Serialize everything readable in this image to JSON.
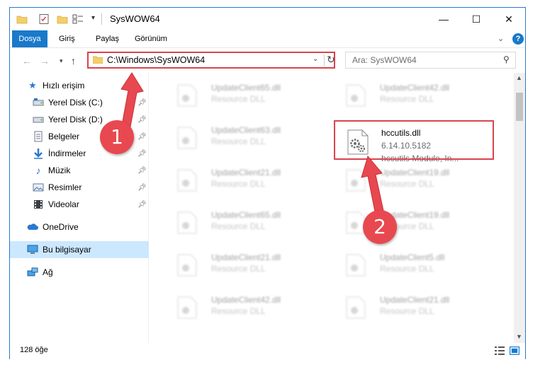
{
  "window": {
    "title": "SysWOW64",
    "controls": {
      "minimize": "—",
      "maximize": "☐",
      "close": "✕"
    }
  },
  "ribbon": {
    "tabs": [
      "Dosya",
      "Giriş",
      "Paylaş",
      "Görünüm"
    ],
    "help": "?"
  },
  "navigation": {
    "address": "C:\\Windows\\SysWOW64",
    "search_placeholder": "Ara: SysWOW64"
  },
  "sidebar": {
    "quick_access": "Hızlı erişim",
    "items": [
      {
        "label": "Yerel Disk (C:)",
        "icon": "drive-icon"
      },
      {
        "label": "Yerel Disk (D:)",
        "icon": "drive-icon"
      },
      {
        "label": "Belgeler",
        "icon": "documents-icon"
      },
      {
        "label": "İndirmeler",
        "icon": "downloads-icon"
      },
      {
        "label": "Müzik",
        "icon": "music-icon"
      },
      {
        "label": "Resimler",
        "icon": "pictures-icon"
      },
      {
        "label": "Videolar",
        "icon": "videos-icon"
      }
    ],
    "onedrive": "OneDrive",
    "this_pc": "Bu bilgisayar",
    "network": "Ağ"
  },
  "files": {
    "left_column": [
      {
        "name": "UpdateClient65.dll",
        "type": "Resource DLL"
      },
      {
        "name": "UpdateClient63.dll",
        "type": "Resource DLL"
      },
      {
        "name": "UpdateClient21.dll",
        "type": "Resource DLL"
      },
      {
        "name": "UpdateClient65.dll",
        "type": "Resource DLL"
      },
      {
        "name": "UpdateClient21.dll",
        "type": "Resource DLL"
      },
      {
        "name": "UpdateClient42.dll",
        "type": "Resource DLL"
      }
    ],
    "right_column": [
      {
        "name": "UpdateClient42.dll",
        "type": "Resource DLL"
      },
      {
        "name": "UpdateClient19.dll",
        "type": "Resource DLL"
      },
      {
        "name": "UpdateClient19.dll",
        "type": "Resource DLL"
      },
      {
        "name": "UpdateClient5.dll",
        "type": "Resource DLL"
      },
      {
        "name": "UpdateClient21.dll",
        "type": "Resource DLL"
      }
    ],
    "target": {
      "name": "hccutils.dll",
      "version": "6.14.10.5182",
      "description": "hccutils Module, In..."
    }
  },
  "status": {
    "count": "128 öğe"
  },
  "annotations": {
    "step1": "1",
    "step2": "2"
  },
  "colors": {
    "accent": "#1979ca",
    "annotation": "#e8484f",
    "selection": "#cce8ff"
  }
}
